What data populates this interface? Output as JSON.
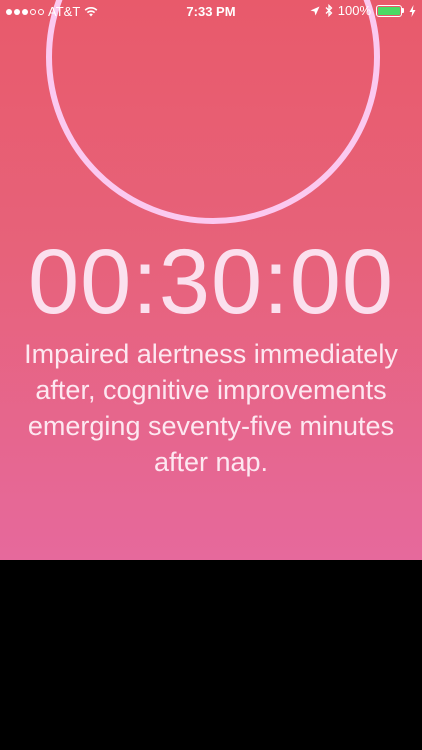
{
  "status_bar": {
    "carrier": "AT&T",
    "time": "7:33 PM",
    "battery_percent": "100%",
    "signal_bars_filled": 3,
    "signal_bars_total": 5,
    "battery_level": 1.0,
    "battery_color": "#4cd964"
  },
  "timer": {
    "display": "00:30:00",
    "ring_color": "#fbc9f0"
  },
  "description": "Impaired alertness immediately after, cognitive improvements emerging seventy-five minutes after nap.",
  "colors": {
    "gradient_top": "#e85a6b",
    "gradient_bottom": "#e6699c",
    "text": "#fbe0ee"
  }
}
